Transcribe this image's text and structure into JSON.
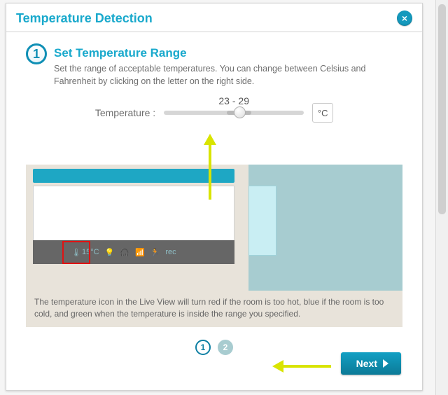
{
  "dialog": {
    "title": "Temperature Detection",
    "close_label": "×"
  },
  "step": {
    "number": "1",
    "title": "Set Temperature Range",
    "description": "Set the range of acceptable temperatures. You can change between Celsius and Fahrenheit by clicking on the letter on the right side."
  },
  "slider": {
    "label": "Temperature :",
    "value_display": "23 - 29",
    "unit": "°C"
  },
  "preview": {
    "temp_readout": "15°C",
    "caption": "The temperature icon in the Live View will turn red if the room is too hot, blue if the room is too cold, and green when the temperature is inside the range you specified."
  },
  "pager": {
    "pages": [
      "1",
      "2"
    ],
    "active": 0
  },
  "buttons": {
    "next": "Next"
  }
}
